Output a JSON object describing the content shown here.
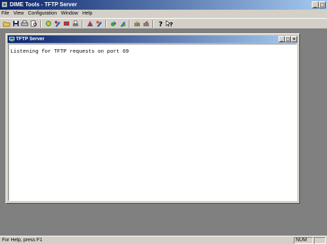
{
  "window": {
    "title": "DIME Tools - TFTP Server"
  },
  "menu": [
    {
      "label": "File",
      "name": "menu-file"
    },
    {
      "label": "View",
      "name": "menu-view"
    },
    {
      "label": "Configuration",
      "name": "menu-configuration"
    },
    {
      "label": "Window",
      "name": "menu-window"
    },
    {
      "label": "Help",
      "name": "menu-help"
    }
  ],
  "toolbar": {
    "icons": [
      "open-icon",
      "save-icon",
      "print-icon",
      "print-preview-icon",
      "tool-icon-1",
      "tool-icon-2",
      "tool-icon-3",
      "tool-icon-4",
      "tool-icon-5",
      "tool-icon-6",
      "tool-icon-7",
      "tool-icon-8",
      "tool-icon-9",
      "tool-icon-10",
      "help-icon",
      "context-help-icon"
    ]
  },
  "child_window": {
    "title": "TFTP Server",
    "content": "Listening for TFTP requests on port 69"
  },
  "status": {
    "text": "For Help, press F1",
    "num": "NUM"
  },
  "colors": {
    "titlebar_start": "#0a246a",
    "titlebar_end": "#a6caf0",
    "face": "#d4d0c8",
    "mdi_bg": "#808080"
  }
}
